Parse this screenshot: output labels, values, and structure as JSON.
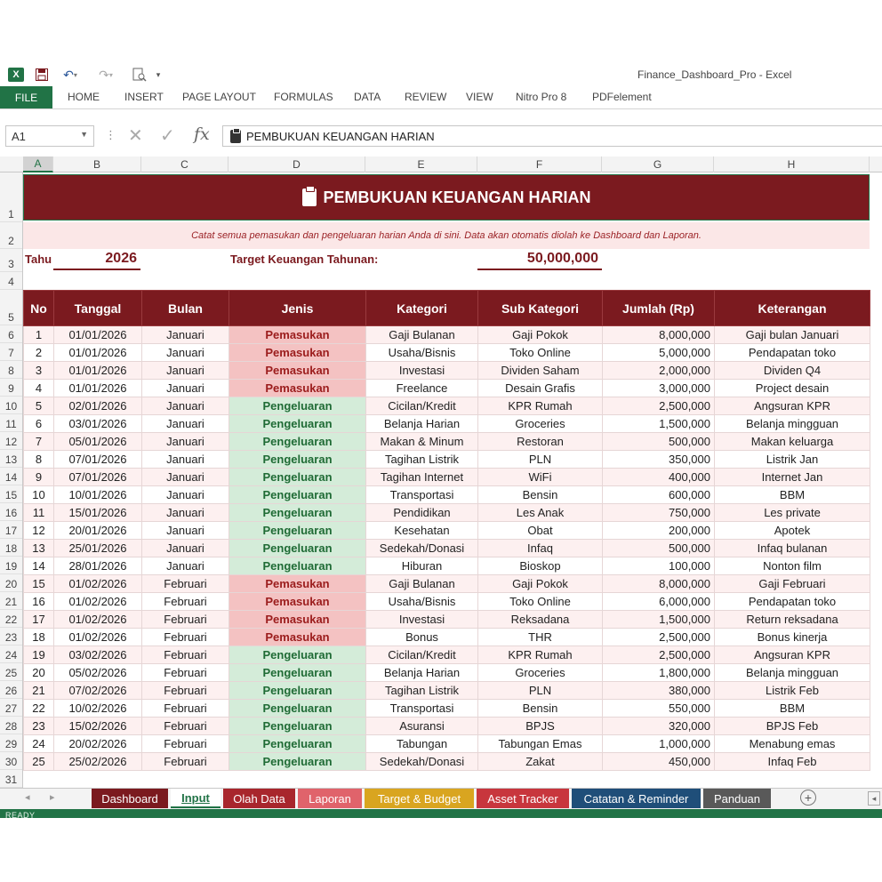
{
  "window": {
    "title": "Finance_Dashboard_Pro - Excel"
  },
  "ribbon": {
    "file": "FILE",
    "tabs": [
      "HOME",
      "INSERT",
      "PAGE LAYOUT",
      "FORMULAS",
      "DATA",
      "REVIEW",
      "VIEW",
      "Nitro Pro 8",
      "PDFelement"
    ]
  },
  "formula_bar": {
    "name_box": "A1",
    "fx": "fx",
    "content": "PEMBUKUAN KEUANGAN HARIAN"
  },
  "columns": [
    "A",
    "B",
    "C",
    "D",
    "E",
    "F",
    "G",
    "H"
  ],
  "rows": [
    "1",
    "2",
    "3",
    "4",
    "5",
    "6",
    "7",
    "8",
    "9",
    "10",
    "11",
    "12",
    "13",
    "14",
    "15",
    "16",
    "17",
    "18",
    "19",
    "20",
    "21",
    "22",
    "23",
    "24",
    "25",
    "26",
    "27",
    "28",
    "29",
    "30",
    "31"
  ],
  "sheet": {
    "title": "PEMBUKUAN KEUANGAN HARIAN",
    "subtitle": "Catat semua pemasukan dan pengeluaran harian Anda di sini. Data akan otomatis diolah ke Dashboard dan Laporan.",
    "year_label": "Tahu",
    "year_value": "2026",
    "target_label": "Target Keuangan Tahunan:",
    "target_value": "50,000,000"
  },
  "table": {
    "headers": [
      "No",
      "Tanggal",
      "Bulan",
      "Jenis",
      "Kategori",
      "Sub Kategori",
      "Jumlah (Rp)",
      "Keterangan"
    ],
    "rows": [
      [
        "1",
        "01/01/2026",
        "Januari",
        "Pemasukan",
        "Gaji Bulanan",
        "Gaji Pokok",
        "8,000,000",
        "Gaji bulan Januari"
      ],
      [
        "2",
        "01/01/2026",
        "Januari",
        "Pemasukan",
        "Usaha/Bisnis",
        "Toko Online",
        "5,000,000",
        "Pendapatan toko"
      ],
      [
        "3",
        "01/01/2026",
        "Januari",
        "Pemasukan",
        "Investasi",
        "Dividen Saham",
        "2,000,000",
        "Dividen Q4"
      ],
      [
        "4",
        "01/01/2026",
        "Januari",
        "Pemasukan",
        "Freelance",
        "Desain Grafis",
        "3,000,000",
        "Project desain"
      ],
      [
        "5",
        "02/01/2026",
        "Januari",
        "Pengeluaran",
        "Cicilan/Kredit",
        "KPR Rumah",
        "2,500,000",
        "Angsuran KPR"
      ],
      [
        "6",
        "03/01/2026",
        "Januari",
        "Pengeluaran",
        "Belanja Harian",
        "Groceries",
        "1,500,000",
        "Belanja mingguan"
      ],
      [
        "7",
        "05/01/2026",
        "Januari",
        "Pengeluaran",
        "Makan & Minum",
        "Restoran",
        "500,000",
        "Makan keluarga"
      ],
      [
        "8",
        "07/01/2026",
        "Januari",
        "Pengeluaran",
        "Tagihan Listrik",
        "PLN",
        "350,000",
        "Listrik Jan"
      ],
      [
        "9",
        "07/01/2026",
        "Januari",
        "Pengeluaran",
        "Tagihan Internet",
        "WiFi",
        "400,000",
        "Internet Jan"
      ],
      [
        "10",
        "10/01/2026",
        "Januari",
        "Pengeluaran",
        "Transportasi",
        "Bensin",
        "600,000",
        "BBM"
      ],
      [
        "11",
        "15/01/2026",
        "Januari",
        "Pengeluaran",
        "Pendidikan",
        "Les Anak",
        "750,000",
        "Les private"
      ],
      [
        "12",
        "20/01/2026",
        "Januari",
        "Pengeluaran",
        "Kesehatan",
        "Obat",
        "200,000",
        "Apotek"
      ],
      [
        "13",
        "25/01/2026",
        "Januari",
        "Pengeluaran",
        "Sedekah/Donasi",
        "Infaq",
        "500,000",
        "Infaq bulanan"
      ],
      [
        "14",
        "28/01/2026",
        "Januari",
        "Pengeluaran",
        "Hiburan",
        "Bioskop",
        "100,000",
        "Nonton film"
      ],
      [
        "15",
        "01/02/2026",
        "Februari",
        "Pemasukan",
        "Gaji Bulanan",
        "Gaji Pokok",
        "8,000,000",
        "Gaji Februari"
      ],
      [
        "16",
        "01/02/2026",
        "Februari",
        "Pemasukan",
        "Usaha/Bisnis",
        "Toko Online",
        "6,000,000",
        "Pendapatan toko"
      ],
      [
        "17",
        "01/02/2026",
        "Februari",
        "Pemasukan",
        "Investasi",
        "Reksadana",
        "1,500,000",
        "Return reksadana"
      ],
      [
        "18",
        "01/02/2026",
        "Februari",
        "Pemasukan",
        "Bonus",
        "THR",
        "2,500,000",
        "Bonus kinerja"
      ],
      [
        "19",
        "03/02/2026",
        "Februari",
        "Pengeluaran",
        "Cicilan/Kredit",
        "KPR Rumah",
        "2,500,000",
        "Angsuran KPR"
      ],
      [
        "20",
        "05/02/2026",
        "Februari",
        "Pengeluaran",
        "Belanja Harian",
        "Groceries",
        "1,800,000",
        "Belanja mingguan"
      ],
      [
        "21",
        "07/02/2026",
        "Februari",
        "Pengeluaran",
        "Tagihan Listrik",
        "PLN",
        "380,000",
        "Listrik Feb"
      ],
      [
        "22",
        "10/02/2026",
        "Februari",
        "Pengeluaran",
        "Transportasi",
        "Bensin",
        "550,000",
        "BBM"
      ],
      [
        "23",
        "15/02/2026",
        "Februari",
        "Pengeluaran",
        "Asuransi",
        "BPJS",
        "320,000",
        "BPJS Feb"
      ],
      [
        "24",
        "20/02/2026",
        "Februari",
        "Pengeluaran",
        "Tabungan",
        "Tabungan Emas",
        "1,000,000",
        "Menabung emas"
      ],
      [
        "25",
        "25/02/2026",
        "Februari",
        "Pengeluaran",
        "Sedekah/Donasi",
        "Zakat",
        "450,000",
        "Infaq Feb"
      ]
    ]
  },
  "sheet_tabs": [
    {
      "label": "Dashboard",
      "color": "#7b1a1f"
    },
    {
      "label": "Input",
      "color": "#ffffff",
      "active": true
    },
    {
      "label": "Olah Data",
      "color": "#a8262c"
    },
    {
      "label": "Laporan",
      "color": "#e0636b"
    },
    {
      "label": "Target & Budget",
      "color": "#d9a520"
    },
    {
      "label": "Asset Tracker",
      "color": "#c8363d"
    },
    {
      "label": "Catatan & Reminder",
      "color": "#1f4e79"
    },
    {
      "label": "Panduan",
      "color": "#595959"
    }
  ],
  "status": {
    "text": "READY"
  },
  "colors": {
    "accent": "#217346",
    "header": "#7b1a1f",
    "income": "#f4c2c2",
    "expense": "#d4ecd9"
  },
  "icons": [
    "excel-logo-icon",
    "save-icon",
    "undo-icon",
    "redo-icon",
    "print-preview-icon",
    "clipboard-icon",
    "add-sheet-icon"
  ]
}
